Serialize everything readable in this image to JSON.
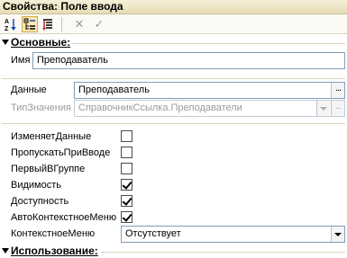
{
  "window": {
    "title": "Свойства: Поле ввода"
  },
  "toolbar": {
    "buttons": [
      {
        "name": "sort-alphabetical-icon",
        "label": "A Z",
        "active": false
      },
      {
        "name": "categorized-view-icon",
        "label": "",
        "active": true
      },
      {
        "name": "filter-icon",
        "label": "",
        "active": false
      },
      {
        "name": "cancel-icon",
        "label": "✕",
        "active": false
      },
      {
        "name": "apply-icon",
        "label": "✓",
        "active": false
      }
    ]
  },
  "groups": {
    "main": {
      "label": "Основные:"
    },
    "usage": {
      "label": "Использование:"
    }
  },
  "properties": {
    "name": {
      "label": "Имя",
      "value": "Преподаватель"
    },
    "data": {
      "label": "Данные",
      "value": "Преподаватель",
      "button": "..."
    },
    "value_type": {
      "label": "ТипЗначения",
      "value": "СправочникСсылка.Преподаватели",
      "button": "..."
    },
    "flags": [
      {
        "label": "ИзменяетДанные",
        "checked": false
      },
      {
        "label": "ПропускатьПриВводе",
        "checked": false
      },
      {
        "label": "ПервыйВГруппе",
        "checked": false
      },
      {
        "label": "Видимость",
        "checked": true
      },
      {
        "label": "Доступность",
        "checked": true
      },
      {
        "label": "АвтоКонтекстноеМеню",
        "checked": true
      }
    ],
    "context_menu": {
      "label": "КонтекстноеМеню",
      "value": "Отсутствует"
    }
  }
}
